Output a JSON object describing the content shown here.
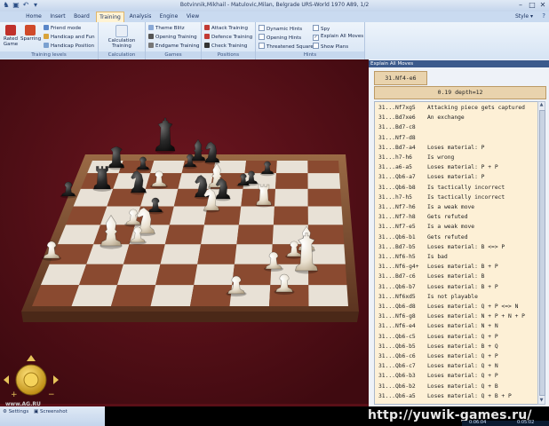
{
  "window": {
    "title": "Botvinnik,Mikhail - Matulovic,Milan, Belgrade URS-World 1970  A89, 1/2"
  },
  "tabs": [
    {
      "label": "Home"
    },
    {
      "label": "Insert"
    },
    {
      "label": "Board"
    },
    {
      "label": "Training"
    },
    {
      "label": "Analysis"
    },
    {
      "label": "Engine"
    },
    {
      "label": "View"
    }
  ],
  "style_label": "Style",
  "ribbon": {
    "training_levels": {
      "label": "Training levels",
      "rated_game": "Rated Game",
      "sparring": "Sparring",
      "friend_mode": "Friend mode",
      "handicap_fun": "Handicap and Fun",
      "handicap_position": "Handicap Position"
    },
    "calculation_training": {
      "label": "Calculation Training",
      "button": "Calculation Training"
    },
    "games": {
      "label": "Games",
      "theme_blitz": "Theme Blitz",
      "opening_training": "Opening Training",
      "endgame_training": "Endgame Training"
    },
    "positions": {
      "label": "Positions",
      "attack_training": "Attack Training",
      "defence_training": "Defence Training",
      "check_training": "Check Training"
    },
    "hints": {
      "label": "Hints",
      "dynamic_hints": "Dynamic Hints",
      "opening_hints": "Opening Hints",
      "threatened_squares": "Threatened Squares",
      "spy": "Spy",
      "explain_all_moves": "Explain All Moves",
      "show_plans": "Show Plans"
    }
  },
  "panel": {
    "title": "Explain All Moves",
    "move": "31.Nf4-e6",
    "eval": "0.19 depth=12",
    "rows": [
      {
        "move": "31...Nf7xg5",
        "text": "Attacking piece gets captured"
      },
      {
        "move": "31...Bd7xe6",
        "text": "An exchange"
      },
      {
        "move": "31...Bd7-c8",
        "text": ""
      },
      {
        "move": "31...Nf7-d8",
        "text": ""
      },
      {
        "move": "31...Bd7-a4",
        "text": "Loses material: P"
      },
      {
        "move": "31...h7-h6",
        "text": "Is wrong"
      },
      {
        "move": "31...a6-a5",
        "text": "Loses material: P + P"
      },
      {
        "move": "31...Qb6-a7",
        "text": "Loses material: P"
      },
      {
        "move": "31...Qb6-b8",
        "text": "Is tactically incorrect"
      },
      {
        "move": "31...h7-h5",
        "text": "Is tactically incorrect"
      },
      {
        "move": "31...Nf7-h6",
        "text": "Is a weak move"
      },
      {
        "move": "31...Nf7-h8",
        "text": "Gets refuted"
      },
      {
        "move": "31...Nf7-e5",
        "text": "Is a weak move"
      },
      {
        "move": "31...Qb6-b1",
        "text": "Gets refuted"
      },
      {
        "move": "31...Bd7-b5",
        "text": "Loses material: B <=> P"
      },
      {
        "move": "31...Nf6-h5",
        "text": "Is bad"
      },
      {
        "move": "31...Nf6-g4+",
        "text": "Loses material: B + P"
      },
      {
        "move": "31...Bd7-c6",
        "text": "Loses material: B"
      },
      {
        "move": "31...Qb6-b7",
        "text": "Loses material: B + P"
      },
      {
        "move": "31...Nf6xd5",
        "text": "Is not playable"
      },
      {
        "move": "31...Qb6-d8",
        "text": "Loses material: Q + P <=> N"
      },
      {
        "move": "31...Nf6-g8",
        "text": "Loses material: N + P + N + P"
      },
      {
        "move": "31...Nf6-e4",
        "text": "Loses material: N + N"
      },
      {
        "move": "31...Qb6-c5",
        "text": "Loses material: Q + P"
      },
      {
        "move": "31...Qb6-b5",
        "text": "Loses material: B + Q"
      },
      {
        "move": "31...Qb6-c6",
        "text": "Loses material: Q + P"
      },
      {
        "move": "31...Qb6-c7",
        "text": "Loses material: Q + N"
      },
      {
        "move": "31...Qb6-b3",
        "text": "Loses material: Q + P"
      },
      {
        "move": "31...Qb6-b2",
        "text": "Loses material: Q + B"
      },
      {
        "move": "31...Qb6-a5",
        "text": "Loses material: Q + B + P"
      }
    ]
  },
  "statusbar": {
    "settings": "Settings",
    "screenshot": "Screenshot",
    "watermark": "http://yuwik-games.ru/",
    "site": "www.AG.RU",
    "clock_white": "0:06:04",
    "clock_black": "0:05:02"
  },
  "colors": {
    "background": "#5a0f17",
    "board_light": "#e8e1d6",
    "board_dark": "#8a4a30",
    "ribbon": "#d6e4f4"
  }
}
